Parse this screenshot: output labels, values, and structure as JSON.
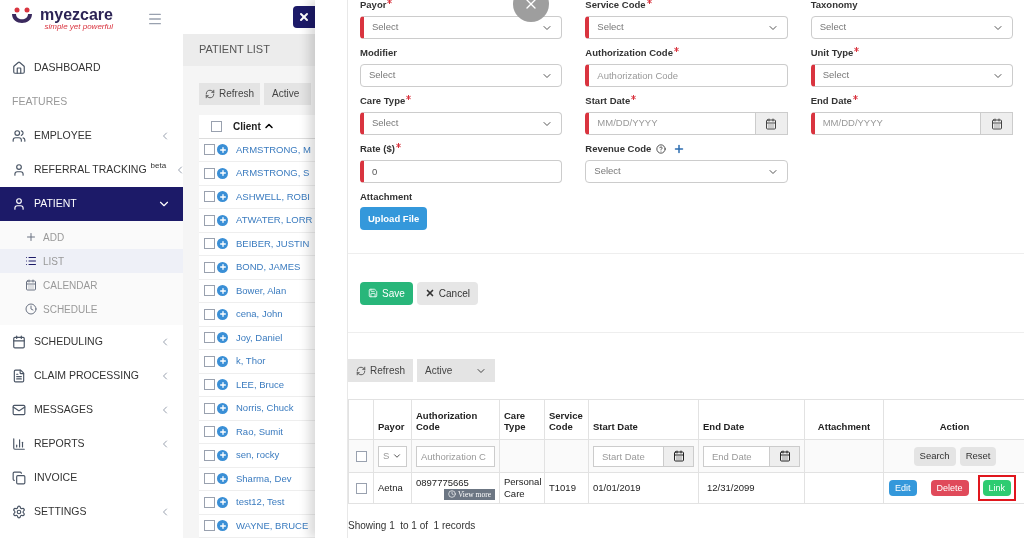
{
  "logo": {
    "name": "myezcare",
    "tagline": "simple yet powerful"
  },
  "sidebar": {
    "items": [
      {
        "label": "DASHBOARD",
        "kind": "item",
        "selected": false
      },
      {
        "label": "FEATURES",
        "kind": "section"
      },
      {
        "label": "EMPLOYEE",
        "kind": "item",
        "expanded": false,
        "selected": false
      },
      {
        "label": "REFERRAL TRACKING",
        "kind": "item",
        "expanded": false,
        "selected": false,
        "badge": "beta"
      },
      {
        "label": "PATIENT",
        "kind": "item",
        "expanded": true,
        "selected": true,
        "children": [
          {
            "label": "ADD",
            "selected": false
          },
          {
            "label": "LIST",
            "selected": true
          },
          {
            "label": "CALENDAR",
            "selected": false
          },
          {
            "label": "SCHEDULE",
            "selected": false
          }
        ]
      },
      {
        "label": "SCHEDULING",
        "kind": "item",
        "expanded": false,
        "selected": false
      },
      {
        "label": "CLAIM PROCESSING",
        "kind": "item",
        "expanded": false,
        "selected": false
      },
      {
        "label": "MESSAGES",
        "kind": "item",
        "expanded": false,
        "selected": false
      },
      {
        "label": "REPORTS",
        "kind": "item",
        "expanded": false,
        "selected": false
      },
      {
        "label": "INVOICE",
        "kind": "item",
        "selected": false
      },
      {
        "label": "SETTINGS",
        "kind": "item",
        "expanded": false,
        "selected": false
      }
    ]
  },
  "patient_list": {
    "title": "PATIENT LIST",
    "refresh": "Refresh",
    "status": "Active",
    "column": "Client",
    "header_checked": false,
    "rows": [
      {
        "name": "ARMSTRONG, M",
        "checked": false
      },
      {
        "name": "ARMSTRONG, S",
        "checked": false
      },
      {
        "name": "ASHWELL, ROBI",
        "checked": false
      },
      {
        "name": "ATWATER, LORR",
        "checked": false
      },
      {
        "name": "BEIBER, JUSTIN",
        "checked": false
      },
      {
        "name": "BOND, JAMES",
        "checked": false
      },
      {
        "name": "Bower, Alan",
        "checked": false
      },
      {
        "name": "cena, John",
        "checked": false
      },
      {
        "name": "Joy, Daniel",
        "checked": false
      },
      {
        "name": "k, Thor",
        "checked": false
      },
      {
        "name": "LEE, Bruce",
        "checked": false
      },
      {
        "name": "Norris, Chuck",
        "checked": false
      },
      {
        "name": "Rao, Sumit",
        "checked": false
      },
      {
        "name": "sen, rocky",
        "checked": false
      },
      {
        "name": "Sharma, Dev",
        "checked": false
      },
      {
        "name": "test12, Test",
        "checked": false
      },
      {
        "name": "WAYNE, BRUCE",
        "checked": false
      }
    ]
  },
  "form": {
    "fields": [
      {
        "label": "Payor",
        "required": true,
        "kind": "select",
        "value": "Select"
      },
      {
        "label": "Service Code",
        "required": true,
        "kind": "select",
        "value": "Select"
      },
      {
        "label": "Taxonomy",
        "required": false,
        "kind": "select",
        "value": "Select"
      },
      {
        "label": "Modifier",
        "required": false,
        "kind": "select",
        "value": "Select"
      },
      {
        "label": "Authorization Code",
        "required": true,
        "kind": "text",
        "placeholder": "Authorization Code"
      },
      {
        "label": "Unit Type",
        "required": true,
        "kind": "select",
        "value": "Select"
      },
      {
        "label": "Care Type",
        "required": true,
        "kind": "select",
        "value": "Select"
      },
      {
        "label": "Start Date",
        "required": true,
        "kind": "date",
        "placeholder": "MM/DD/YYYY"
      },
      {
        "label": "End Date",
        "required": true,
        "kind": "date",
        "placeholder": "MM/DD/YYYY"
      },
      {
        "label": "Rate ($)",
        "required": true,
        "kind": "text",
        "value": "0"
      },
      {
        "label": "Revenue Code",
        "required": false,
        "kind": "select",
        "value": "Select",
        "help": true
      }
    ],
    "attachment_label": "Attachment",
    "upload": "Upload File",
    "save": "Save",
    "cancel": "Cancel"
  },
  "auth_table": {
    "refresh": "Refresh",
    "status": "Active",
    "header_checked": false,
    "columns": [
      "Payor",
      "Authorization Code",
      "Care Type",
      "Service Code",
      "Start Date",
      "End Date",
      "Attachment",
      "Action"
    ],
    "filters": {
      "payor": "S",
      "auth_placeholder": "Authorization C",
      "start_placeholder": "Start Date",
      "end_placeholder": "End Date",
      "search": "Search",
      "reset": "Reset"
    },
    "rows": [
      {
        "checked": false,
        "payor": "Aetna",
        "auth_code": "0897775665",
        "view_more": "View more",
        "care_type": "Personal Care",
        "service_code": "T1019",
        "start": "01/01/2019",
        "end": "12/31/2099",
        "actions": [
          {
            "label": "Edit",
            "kind": "edit",
            "highlighted": false
          },
          {
            "label": "Delete",
            "kind": "delete",
            "highlighted": false
          },
          {
            "label": "Link",
            "kind": "link",
            "highlighted": true
          }
        ]
      }
    ],
    "footer": "Showing 1  to 1 of  1 records"
  }
}
